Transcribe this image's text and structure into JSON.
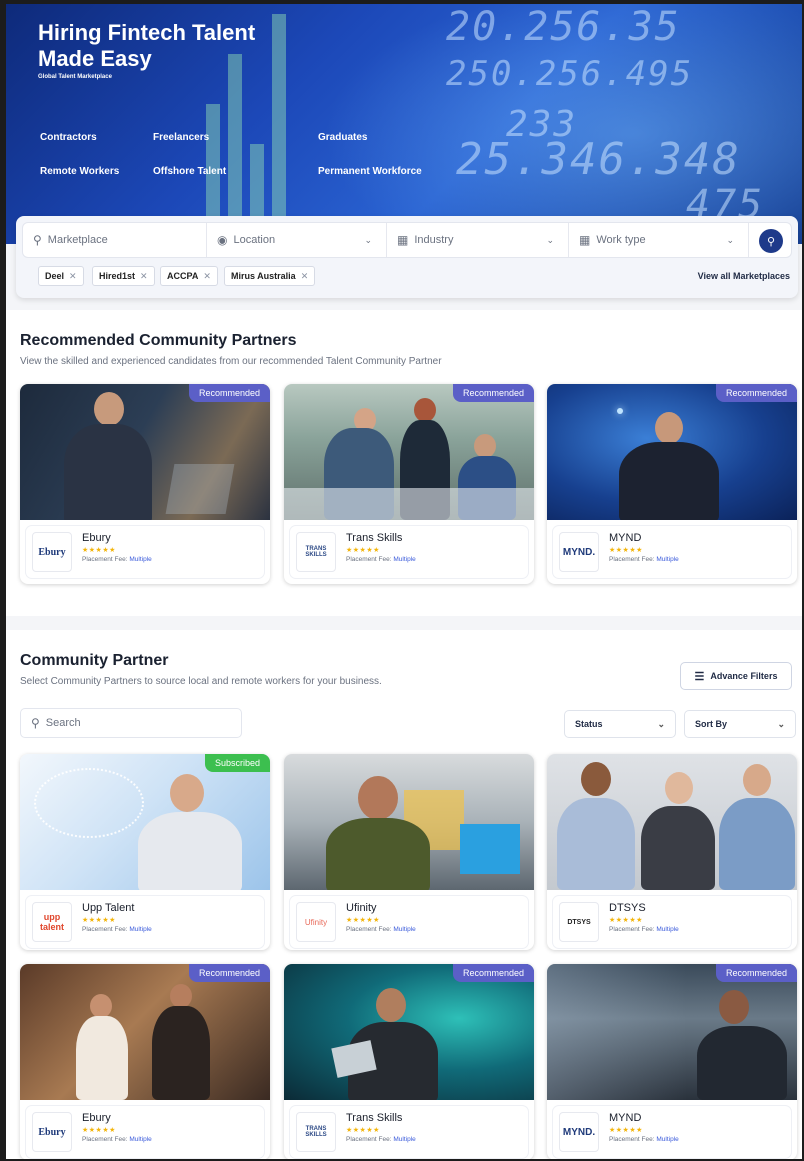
{
  "hero": {
    "title": "Hiring Fintech Talent Made Easy",
    "subtitle": "Global Talent Marketplace",
    "links": [
      "Contractors",
      "Freelancers",
      "Graduates",
      "Remote Workers",
      "Offshore Talent",
      "Permanent Workforce"
    ],
    "tickers": [
      "20.256.35",
      "250.256.495",
      "233",
      "25.346.348",
      "475"
    ]
  },
  "search": {
    "marketplace_placeholder": "Marketplace",
    "location_placeholder": "Location",
    "industry_placeholder": "Industry",
    "worktype_placeholder": "Work type",
    "chips": [
      "Deel",
      "Hired1st",
      "ACCPA",
      "Mirus Australia"
    ],
    "view_all": "View all Marketplaces"
  },
  "recommended": {
    "title": "Recommended Community Partners",
    "subtitle": "View the skilled and experienced candidates from our recommended Talent Community Partner",
    "cards": [
      {
        "name": "Ebury",
        "badge": "Recommended",
        "logo_text": "Ebury",
        "fee_label": "Placement Fee:",
        "fee_value": "Multiple",
        "rating": "★★★★★"
      },
      {
        "name": "Trans Skills",
        "badge": "Recommended",
        "logo_text": "TRANS SKILLS",
        "fee_label": "Placement Fee:",
        "fee_value": "Multiple",
        "rating": "★★★★★"
      },
      {
        "name": "MYND",
        "badge": "Recommended",
        "logo_text": "MYND.",
        "fee_label": "Placement Fee:",
        "fee_value": "Multiple",
        "rating": "★★★★★"
      }
    ]
  },
  "community": {
    "title": "Community Partner",
    "subtitle": "Select Community Partners to source local and remote workers for your business.",
    "advance_filters": "Advance Filters",
    "search_placeholder": "Search",
    "status_label": "Status",
    "sort_label": "Sort By",
    "cards": [
      {
        "name": "Upp Talent",
        "badge": "Subscribed",
        "logo_text": "upp talent",
        "fee_label": "Placement Fee:",
        "fee_value": "Multiple",
        "rating": "★★★★★"
      },
      {
        "name": "Ufinity",
        "badge": "",
        "logo_text": "Ufinity",
        "fee_label": "Placement Fee:",
        "fee_value": "Multiple",
        "rating": "★★★★★"
      },
      {
        "name": "DTSYS",
        "badge": "",
        "logo_text": "DTSYS",
        "fee_label": "Placement Fee:",
        "fee_value": "Multiple",
        "rating": "★★★★★"
      },
      {
        "name": "Ebury",
        "badge": "Recommended",
        "logo_text": "Ebury",
        "fee_label": "Placement Fee:",
        "fee_value": "Multiple",
        "rating": "★★★★★"
      },
      {
        "name": "Trans Skills",
        "badge": "Recommended",
        "logo_text": "TRANS SKILLS",
        "fee_label": "Placement Fee:",
        "fee_value": "Multiple",
        "rating": "★★★★★"
      },
      {
        "name": "MYND",
        "badge": "Recommended",
        "logo_text": "MYND.",
        "fee_label": "Placement Fee:",
        "fee_value": "Multiple",
        "rating": "★★★★★"
      }
    ]
  },
  "colors": {
    "accent": "#1e3a8a",
    "recommended_badge": "#5b5fc7",
    "subscribed_badge": "#3cbf4f",
    "stars": "#f3b50c"
  }
}
